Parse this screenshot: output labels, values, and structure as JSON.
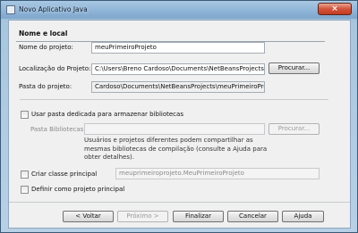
{
  "window": {
    "title": "Novo Aplicativo Java",
    "close_glyph": "×"
  },
  "section": {
    "title": "Nome e local"
  },
  "project_name": {
    "label": "Nome do projeto:",
    "value": "meuPrimeiroProjeto"
  },
  "project_location": {
    "label": "Localização do Projeto:",
    "value": "C:\\Users\\Breno Cardoso\\Documents\\NetBeansProjects",
    "browse_label": "Procurar..."
  },
  "project_folder": {
    "label": "Pasta do projeto:",
    "value": "Cardoso\\Documents\\NetBeansProjects\\meuPrimeiroProjeto"
  },
  "libraries": {
    "checkbox_label": "Usar pasta dedicada para armazenar bibliotecas",
    "folder_label": "Pasta Bibliotecas:",
    "folder_value": "",
    "browse_label": "Procurar...",
    "description": "Usuários e projetos diferentes podem compartilhar as mesmas bibliotecas de compilação (consulte a Ajuda para obter detalhes)."
  },
  "main_class": {
    "checkbox_label": "Criar classe principal",
    "value": "meuprimeiroprojeto.MeuPrimeiroProjeto"
  },
  "set_main": {
    "checkbox_label": "Definir como projeto principal"
  },
  "buttons": {
    "back": "< Voltar",
    "next": "Próximo >",
    "finish": "Finalizar",
    "cancel": "Cancelar",
    "help": "Ajuda"
  }
}
